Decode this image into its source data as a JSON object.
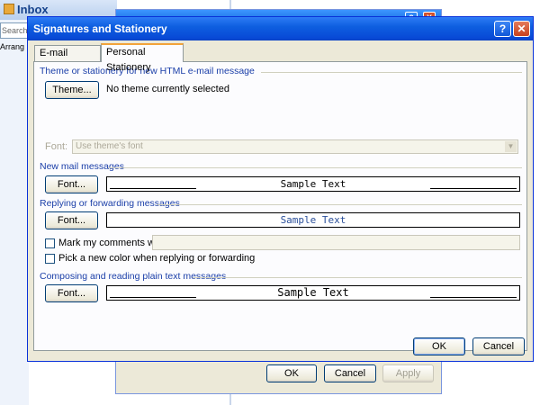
{
  "background": {
    "inbox": {
      "title": "Inbox",
      "search_placeholder": "Search",
      "arrange_label": "Arrang"
    },
    "dialog": {
      "title_buttons": {
        "help": "?",
        "close": "X"
      },
      "buttons": {
        "ok": "OK",
        "cancel": "Cancel",
        "apply": "Apply"
      }
    }
  },
  "dialog": {
    "title": "Signatures and Stationery",
    "title_buttons": {
      "help": "?",
      "close": "✕"
    },
    "tabs": [
      {
        "label": "E-mail Signature",
        "active": false
      },
      {
        "label": "Personal Stationery",
        "active": true
      }
    ],
    "theme_section": {
      "heading": "Theme or stationery for new HTML e-mail message",
      "theme_button": "Theme...",
      "status": "No theme currently selected",
      "font_label": "Font:",
      "font_value": "Use theme's font"
    },
    "new_mail": {
      "heading": "New mail messages",
      "font_button": "Font...",
      "sample": "Sample Text"
    },
    "reply": {
      "heading": "Replying or forwarding messages",
      "font_button": "Font...",
      "sample": "Sample Text",
      "mark_comments_label": "Mark my comments with:",
      "pick_color_label": "Pick a new color when replying or forwarding"
    },
    "plain_text": {
      "heading": "Composing and reading plain text messages",
      "font_button": "Font...",
      "sample": "Sample Text"
    },
    "footer": {
      "ok": "OK",
      "cancel": "Cancel"
    }
  },
  "colors": {
    "title_bar": "#0a4fd8",
    "section_heading": "#1a3ea8",
    "dialog_face": "#ece9d8",
    "reply_sample_text": "#2a4f9a"
  }
}
